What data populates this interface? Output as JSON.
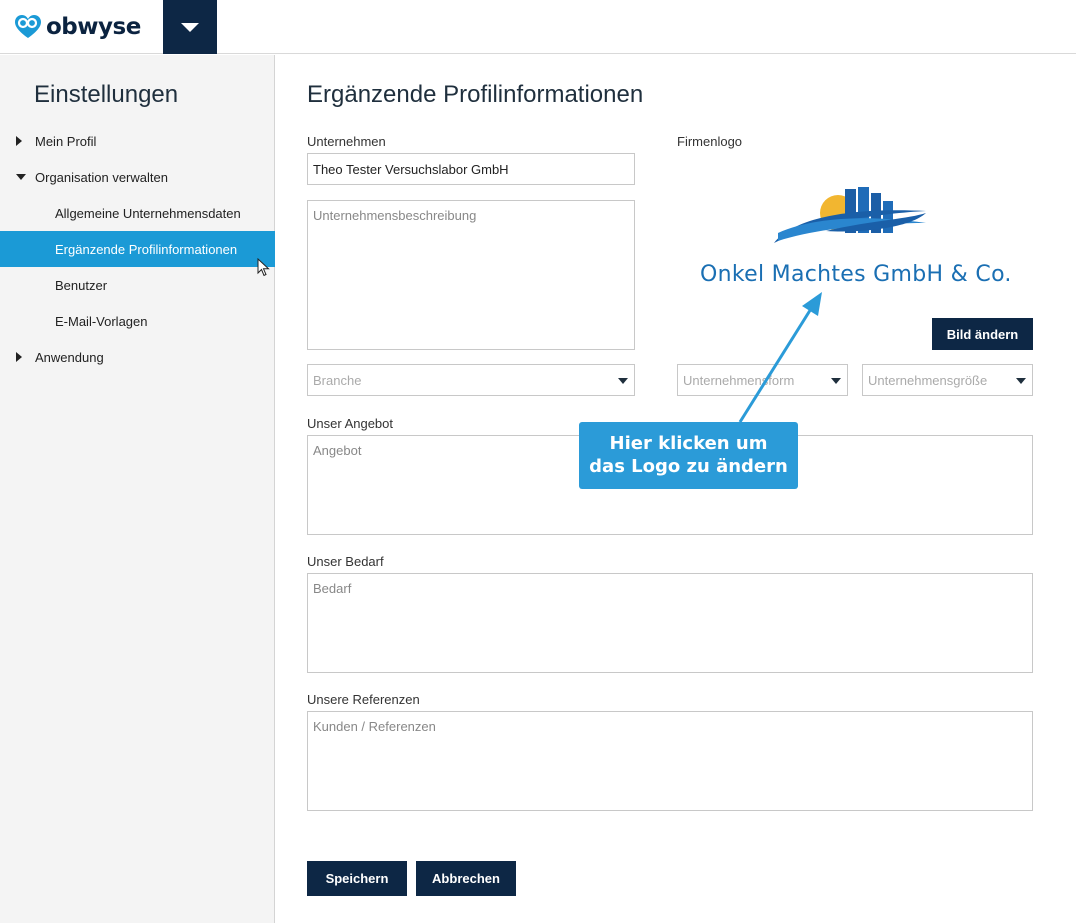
{
  "brand": {
    "name": "obwyse"
  },
  "sidebar": {
    "title": "Einstellungen",
    "items": [
      {
        "label": "Mein Profil"
      },
      {
        "label": "Organisation verwalten"
      },
      {
        "label": "Allgemeine Unternehmensdaten"
      },
      {
        "label": "Ergänzende Profilinformationen"
      },
      {
        "label": "Benutzer"
      },
      {
        "label": "E-Mail-Vorlagen"
      },
      {
        "label": "Anwendung"
      }
    ]
  },
  "main": {
    "title": "Ergänzende Profilinformationen",
    "company_label": "Unternehmen",
    "company_value": "Theo Tester Versuchslabor GmbH",
    "description_placeholder": "Unternehmensbeschreibung",
    "logo_label": "Firmenlogo",
    "logo_company_name": "Onkel Machtes GmbH & Co.",
    "change_image_button": "Bild ändern",
    "branche_placeholder": "Branche",
    "unternehmensform_placeholder": "Unternehmensform",
    "unternehmensgroesse_placeholder": "Unternehmensgröße",
    "offer_label": "Unser Angebot",
    "offer_placeholder": "Angebot",
    "need_label": "Unser Bedarf",
    "need_placeholder": "Bedarf",
    "references_label": "Unsere Referenzen",
    "references_placeholder": "Kunden / Referenzen",
    "save_button": "Speichern",
    "cancel_button": "Abbrechen"
  },
  "callout": {
    "line1": "Hier klicken um",
    "line2": "das Logo zu ändern"
  },
  "colors": {
    "navy": "#0d2745",
    "accent": "#1b9ad6",
    "callout": "#2b9bd8"
  }
}
